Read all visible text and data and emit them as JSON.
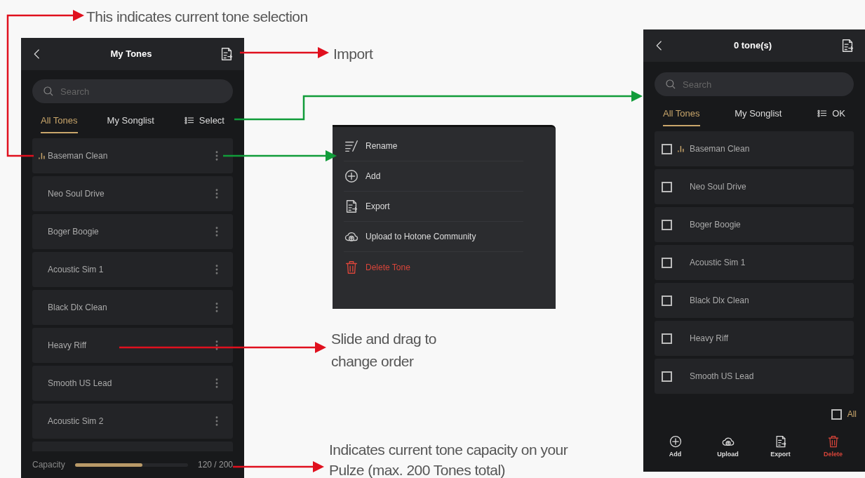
{
  "annotations": {
    "selection_note": "This indicates current tone selection",
    "import_note": "Import",
    "drag_note": [
      "Slide and drag to",
      "change order"
    ],
    "capacity_note": [
      "Indicates current tone capacity on your",
      "Pulze (max. 200 Tones total)"
    ]
  },
  "my_tones_screen": {
    "title": "My Tones",
    "search": {
      "placeholder": "Search"
    },
    "tabs": [
      {
        "label": "All Tones",
        "selected": true
      },
      {
        "label": "My Songlist",
        "selected": false
      }
    ],
    "select_button": "Select",
    "tones": [
      {
        "name": "Baseman Clean",
        "current": true
      },
      {
        "name": "Neo Soul Drive",
        "current": false
      },
      {
        "name": "Boger Boogie",
        "current": false
      },
      {
        "name": "Acoustic Sim 1",
        "current": false
      },
      {
        "name": "Black Dlx Clean",
        "current": false
      },
      {
        "name": "Heavy Riff",
        "current": false
      },
      {
        "name": "Smooth US Lead",
        "current": false
      },
      {
        "name": "Acoustic Sim 2",
        "current": false
      }
    ],
    "capacity": {
      "label": "Capacity",
      "level": 0.6,
      "reading": "120 / 200"
    }
  },
  "tone_menu": {
    "items": [
      {
        "kind": "rename",
        "label": "Rename"
      },
      {
        "kind": "add",
        "label": "Add"
      },
      {
        "kind": "export",
        "label": "Export"
      },
      {
        "kind": "upload",
        "label": "Upload to Hotone Community"
      },
      {
        "kind": "delete",
        "label": "Delete Tone"
      }
    ]
  },
  "select_screen": {
    "title": "0 tone(s)",
    "search": {
      "placeholder": "Search"
    },
    "tabs": [
      {
        "label": "All Tones",
        "selected": true
      },
      {
        "label": "My Songlist",
        "selected": false
      }
    ],
    "ok_button": "OK",
    "tones": [
      {
        "name": "Baseman Clean",
        "current": true,
        "checked": false
      },
      {
        "name": "Neo Soul Drive",
        "current": false,
        "checked": false
      },
      {
        "name": "Boger Boogie",
        "current": false,
        "checked": false
      },
      {
        "name": "Acoustic Sim 1",
        "current": false,
        "checked": false
      },
      {
        "name": "Black Dlx Clean",
        "current": false,
        "checked": false
      },
      {
        "name": "Heavy Riff",
        "current": false,
        "checked": false
      },
      {
        "name": "Smooth US Lead",
        "current": false,
        "checked": false
      }
    ],
    "select_all": {
      "label": "All",
      "checked": false
    },
    "actions": [
      {
        "kind": "add",
        "label": "Add"
      },
      {
        "kind": "upload",
        "label": "Upload"
      },
      {
        "kind": "export",
        "label": "Export"
      },
      {
        "kind": "delete",
        "label": "Delete"
      }
    ]
  }
}
